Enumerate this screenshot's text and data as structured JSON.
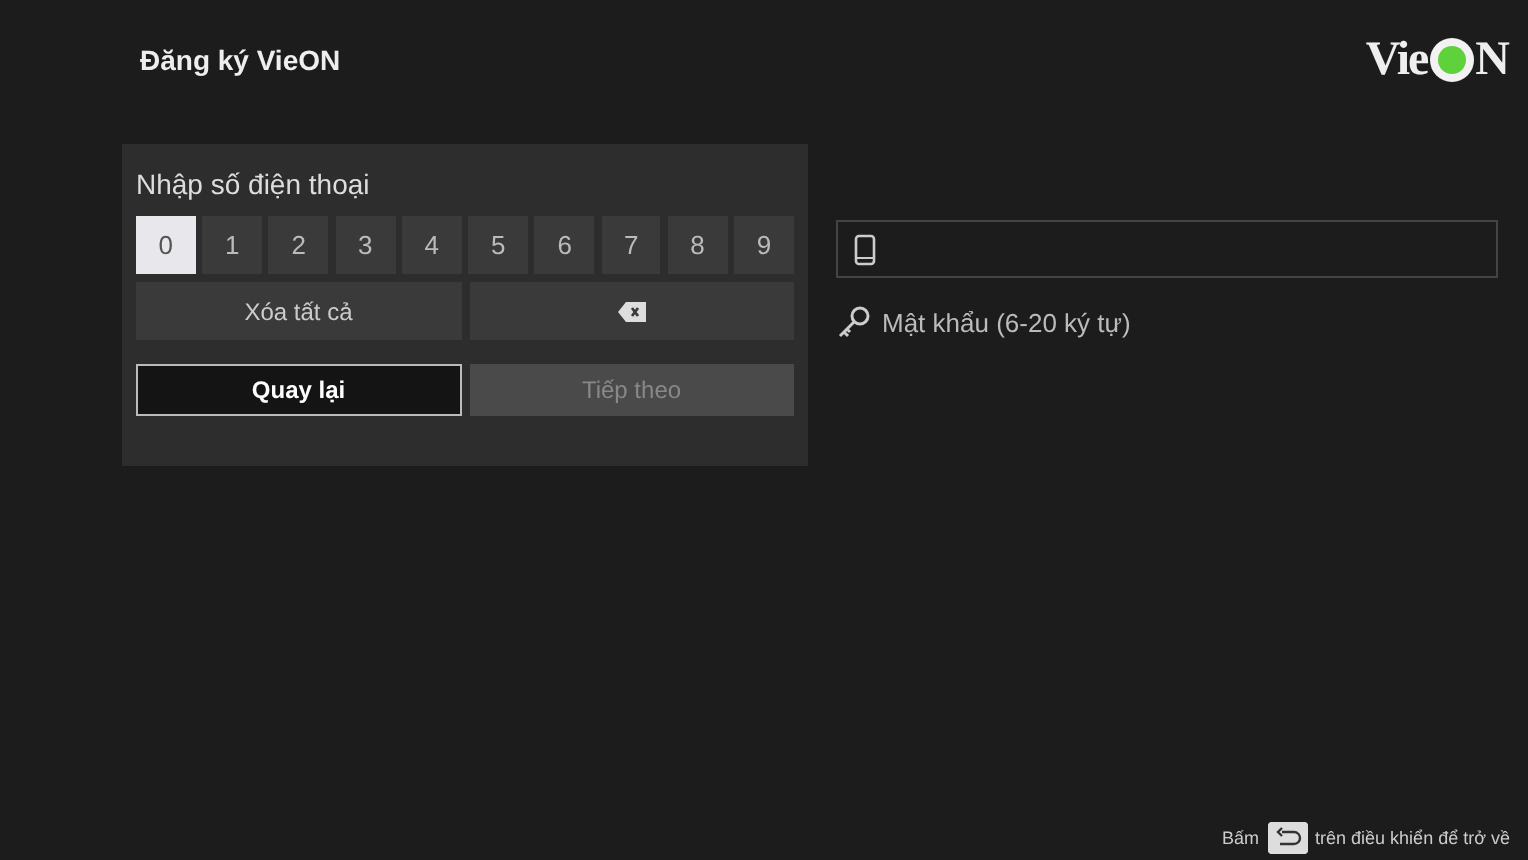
{
  "header": {
    "title": "Đăng ký VieON",
    "logo": {
      "left": "Vie",
      "right": "N"
    }
  },
  "keypad": {
    "label": "Nhập số điện thoại",
    "keys": [
      {
        "label": "0",
        "selected": true
      },
      {
        "label": "1",
        "selected": false
      },
      {
        "label": "2",
        "selected": false
      },
      {
        "label": "3",
        "selected": false
      },
      {
        "label": "4",
        "selected": false
      },
      {
        "label": "5",
        "selected": false
      },
      {
        "label": "6",
        "selected": false
      },
      {
        "label": "7",
        "selected": false
      },
      {
        "label": "8",
        "selected": false
      },
      {
        "label": "9",
        "selected": false
      }
    ],
    "clear_all": "Xóa tất cả",
    "back": {
      "label": "Quay lại",
      "selected": true
    },
    "next": {
      "label": "Tiếp theo",
      "disabled": true
    }
  },
  "form": {
    "password_label": "Mật khẩu (6-20 ký tự)"
  },
  "footer": {
    "before": "Bấm",
    "after": "trên điều khiển để trở về"
  }
}
